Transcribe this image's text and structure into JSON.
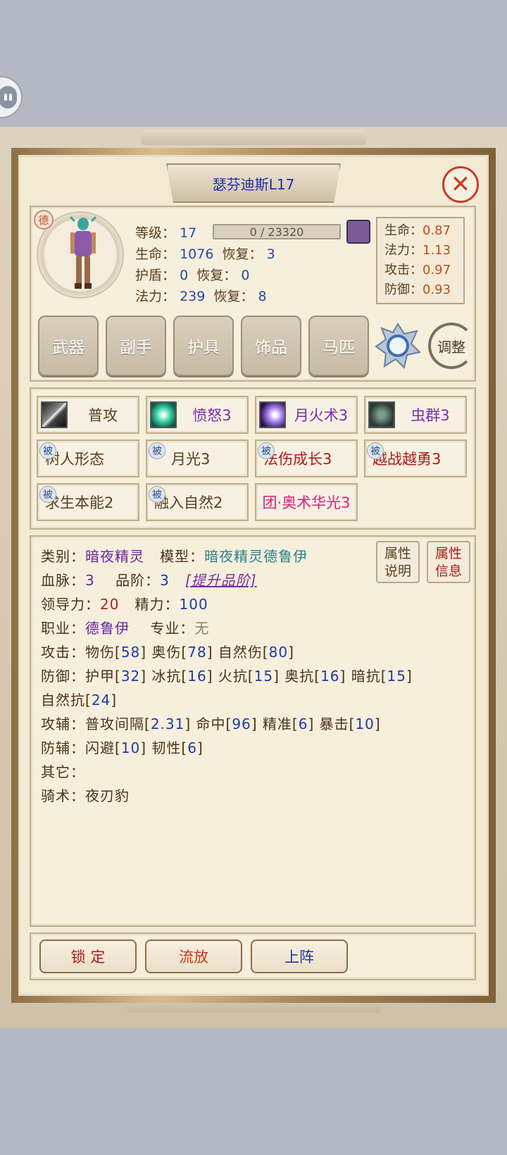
{
  "title": "瑟芬迪斯L17",
  "close_glyph": "✕",
  "race_badge": "德",
  "stats": {
    "level_label": "等级：",
    "level": "17",
    "exp_text": "0 / 23320",
    "hp_label": "生命：",
    "hp": "1076",
    "hp_regen_label": "恢复：",
    "hp_regen": "3",
    "shield_label": "护盾：",
    "shield": "0",
    "shield_regen_label": "恢复：",
    "shield_regen": "0",
    "mp_label": "法力：",
    "mp": "239",
    "mp_regen_label": "恢复：",
    "mp_regen": "8"
  },
  "ratios": [
    {
      "label": "生命：",
      "value": "0.87"
    },
    {
      "label": "法力：",
      "value": "1.13"
    },
    {
      "label": "攻击：",
      "value": "0.97"
    },
    {
      "label": "防御：",
      "value": "0.93"
    }
  ],
  "equip_buttons": [
    "武器",
    "副手",
    "护具",
    "饰品",
    "马匹"
  ],
  "adjust_label": "调整",
  "skills": [
    {
      "name": "普攻",
      "color": "#5a3e1e",
      "icon": "sword-icon"
    },
    {
      "name": "愤怒3",
      "color": "#7b2bb0",
      "icon": "rage-icon"
    },
    {
      "name": "月火术3",
      "color": "#7b2bb0",
      "icon": "moonfire-icon"
    },
    {
      "name": "虫群3",
      "color": "#7b2bb0",
      "icon": "swarm-icon"
    }
  ],
  "passive_tag": "被",
  "passives": [
    {
      "name": "树人形态",
      "color": "#5a3e1e"
    },
    {
      "name": "月光3",
      "color": "#5a3e1e"
    },
    {
      "name": "法伤成长3",
      "color": "#b01818"
    },
    {
      "name": "越战越勇3",
      "color": "#b01818"
    },
    {
      "name": "求生本能2",
      "color": "#5a3e1e"
    },
    {
      "name": "融入自然2",
      "color": "#5a3e1e"
    }
  ],
  "team_skill": {
    "name": "团·奥术华光3",
    "color": "#d8207a"
  },
  "info": {
    "category_label": "类别：",
    "category": "暗夜精灵",
    "model_label": "模型：",
    "model": "暗夜精灵德鲁伊",
    "bloodline_label": "血脉：",
    "bloodline": "3",
    "grade_label": "品阶：",
    "grade": "3",
    "upgrade_link": "[提升品阶]",
    "leadership_label": "领导力：",
    "leadership": "20",
    "energy_label": "精力：",
    "energy": "100",
    "job_label": "职业：",
    "job": "德鲁伊",
    "major_label": "专业：",
    "major": "无",
    "attack_label": "攻击：",
    "attack_phys_label": "物伤[",
    "attack_phys": "58",
    "attack_arcane_label": "] 奥伤[",
    "attack_arcane": "78",
    "attack_nature_label": "] 自然伤[",
    "attack_nature": "80",
    "close_bracket": "]",
    "defense_label": "防御：",
    "armor_label": "护甲[",
    "armor": "32",
    "frost_label": "] 冰抗[",
    "frost": "16",
    "fire_label": "] 火抗[",
    "fire": "15",
    "arcane_res_label": "] 奥抗[",
    "arcane_res": "16",
    "shadow_label": "] 暗抗[",
    "shadow": "15",
    "nature_res_label": "自然抗[",
    "nature_res": "24",
    "atk_aux_label": "攻辅：",
    "interval_label": "普攻间隔[",
    "interval": "2.31",
    "hit_label": "] 命中[",
    "hit": "96",
    "precision_label": "] 精准[",
    "precision": "6",
    "crit_label": "] 暴击[",
    "crit": "10",
    "def_aux_label": "防辅：",
    "dodge_label": "闪避[",
    "dodge": "10",
    "tough_label": "] 韧性[",
    "tough": "6",
    "other_label": "其它：",
    "mount_label": "骑术：",
    "mount": "夜刃豹"
  },
  "side_buttons": {
    "attr_desc_1": "属性",
    "attr_desc_2": "说明",
    "attr_info_1": "属性",
    "attr_info_2": "信息"
  },
  "bottom_buttons": {
    "lock": "锁 定",
    "exile": "流放",
    "deploy": "上阵"
  }
}
